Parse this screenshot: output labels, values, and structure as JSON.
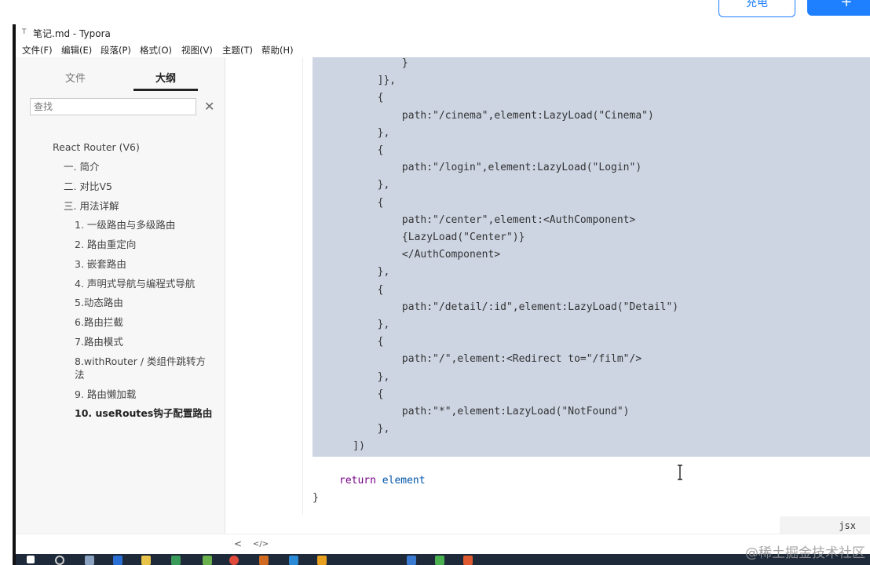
{
  "page_top_buttons": {
    "outline_label": "充电",
    "solid_label": "+"
  },
  "window": {
    "title": "笔记.md - Typora",
    "app_icon": "T"
  },
  "menu": [
    "文件(F)",
    "编辑(E)",
    "段落(P)",
    "格式(O)",
    "视图(V)",
    "主题(T)",
    "帮助(H)"
  ],
  "sidebar": {
    "tabs": [
      "文件",
      "大纲"
    ],
    "active_tab": "大纲",
    "search_placeholder": "查找",
    "outline": [
      "React Router (V6)",
      "一. 简介",
      "二. 对比V5",
      "三. 用法详解",
      "1. 一级路由与多级路由",
      "2. 路由重定向",
      "3. 嵌套路由",
      "4. 声明式导航与编程式导航",
      "5.动态路由",
      "6.路由拦截",
      "7.路由模式",
      "8.withRouter / 类组件跳转方",
      "法",
      "9. 路由懒加载",
      "10. useRoutes钩子配置路由"
    ],
    "active_item": "10. useRoutes钩子配置路由"
  },
  "editor": {
    "code_lines": [
      "            }",
      "        ]},",
      "        {",
      "            path:\"/cinema\",element:LazyLoad(\"Cinema\")",
      "        },",
      "        {",
      "            path:\"/login\",element:LazyLoad(\"Login\")",
      "        },",
      "        {",
      "            path:\"/center\",element:<AuthComponent>",
      "            {LazyLoad(\"Center\")}",
      "            </AuthComponent>",
      "        },",
      "        {",
      "            path:\"/detail/:id\",element:LazyLoad(\"Detail\")",
      "        },",
      "        {",
      "            path:\"/\",element:<Redirect to=\"/film\"/>",
      "        },",
      "        {",
      "            path:\"*\",element:LazyLoad(\"NotFound\")",
      "        },",
      "    ])"
    ],
    "return_keyword": "return",
    "return_var": "element",
    "closing_brace": "}",
    "language": "jsx"
  },
  "statusbar": {
    "left_icon": "<",
    "source_icon": "</>"
  },
  "watermark": "@稀土掘金技术社区",
  "colors": {
    "code_bg": "#cdd5e3",
    "accent": "#1e80ff",
    "taskbar": "#1e2a3a"
  }
}
